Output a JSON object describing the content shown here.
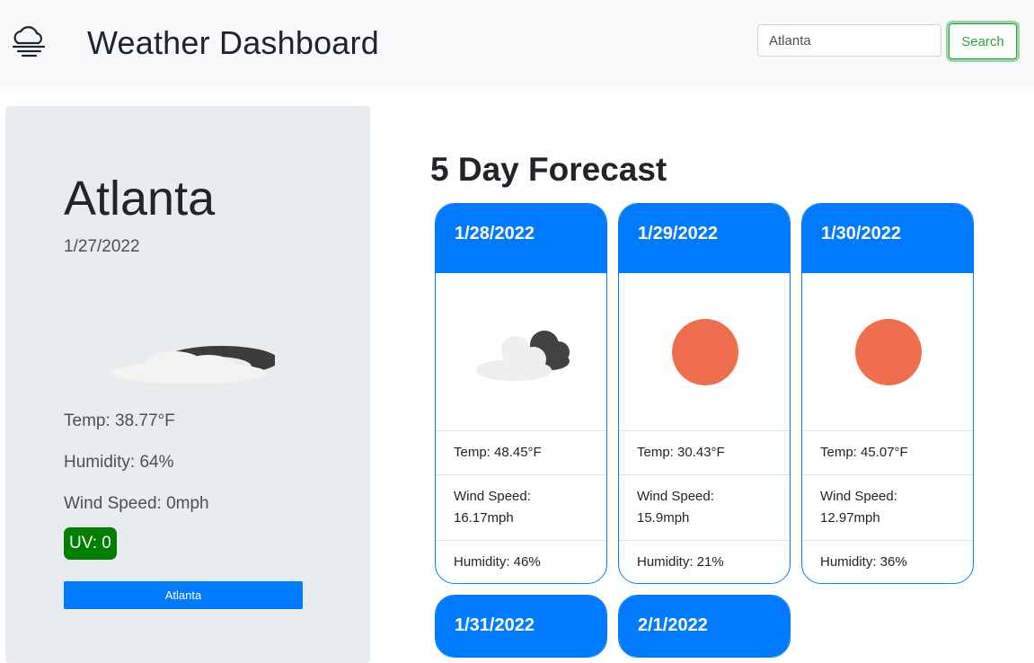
{
  "header": {
    "title": "Weather Dashboard",
    "icon": "fog-cloud-icon",
    "search": {
      "value": "Atlanta",
      "placeholder": ""
    },
    "search_label": "Search"
  },
  "current": {
    "city": "Atlanta",
    "date": "1/27/2022",
    "icon": "partly-cloudy-night-icon",
    "temp": "Temp: 38.77°F",
    "humidity": "Humidity: 64%",
    "wind": "Wind Speed: 0mph",
    "uv": "UV: 0",
    "uv_color": "#008000"
  },
  "history": [
    {
      "label": "Atlanta"
    }
  ],
  "forecast": {
    "title": "5 Day Forecast",
    "days": [
      {
        "date": "1/28/2022",
        "icon": "cloudy-icon",
        "temp": "Temp: 48.45°F",
        "wind_label": "Wind Speed:",
        "wind_value": "16.17mph",
        "humidity": "Humidity: 46%"
      },
      {
        "date": "1/29/2022",
        "icon": "sun-icon",
        "temp": "Temp: 30.43°F",
        "wind_label": "Wind Speed:",
        "wind_value": "15.9mph",
        "humidity": "Humidity: 21%"
      },
      {
        "date": "1/30/2022",
        "icon": "sun-icon",
        "temp": "Temp: 45.07°F",
        "wind_label": "Wind Speed:",
        "wind_value": "12.97mph",
        "humidity": "Humidity: 36%"
      },
      {
        "date": "1/31/2022"
      },
      {
        "date": "2/1/2022"
      }
    ]
  },
  "colors": {
    "accent": "#007bff",
    "search_border": "#28a745",
    "sun": "#ef6e4d",
    "panel": "#e9ecef"
  }
}
